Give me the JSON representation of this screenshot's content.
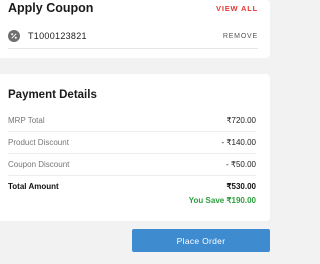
{
  "coupon": {
    "title": "Apply Coupon",
    "view_all": "VIEW ALL",
    "applied_code": "T1000123821",
    "remove": "REMOVE",
    "icon": "coupon-tag-icon"
  },
  "payment": {
    "title": "Payment Details",
    "rows": [
      {
        "label": "MRP Total",
        "value": "₹720.00"
      },
      {
        "label": "Product Discount",
        "value": "- ₹140.00"
      },
      {
        "label": "Coupon Discount",
        "value": "- ₹50.00"
      },
      {
        "label": "Total Amount",
        "value": "₹530.00"
      }
    ],
    "you_save": "You Save ₹190.00"
  },
  "actions": {
    "place_order": "Place Order"
  },
  "colors": {
    "accent_red": "#e53935",
    "save_green": "#2e9e3e",
    "button_blue": "#3f8bd0"
  }
}
